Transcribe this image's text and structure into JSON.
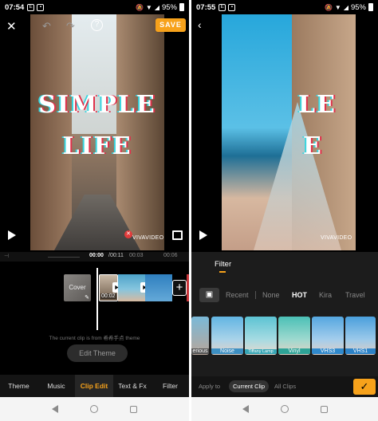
{
  "left": {
    "status": {
      "time": "07:54",
      "battery": "95%"
    },
    "top_bar": {
      "save_label": "SAVE"
    },
    "video": {
      "title_line1": "SIMPLE",
      "title_line2": "LIFE",
      "watermark": "VIVAVIDEO"
    },
    "timeline": {
      "current_time": "00:00",
      "total_time": "/00:11",
      "tick_1": "00:03",
      "tick_2": "00:06"
    },
    "clips": {
      "cover_label": "Cover",
      "clip_duration": "00:02",
      "hint": "The current clip is from 希希手点 theme",
      "edit_theme_label": "Edit Theme"
    },
    "tabs": [
      "Theme",
      "Music",
      "Clip Edit",
      "Text & Fx",
      "Filter"
    ],
    "active_tab": "Clip Edit"
  },
  "right": {
    "status": {
      "time": "07:55",
      "battery": "95%"
    },
    "video": {
      "title_fragment": "LE",
      "title_fragment_2": "E",
      "watermark": "VIVAVIDEO"
    },
    "filter": {
      "header": "Filter",
      "categories": [
        "Recent",
        "None",
        "HOT",
        "Kira",
        "Travel"
      ],
      "active_category": "HOT",
      "items": [
        "erious",
        "Noise",
        "Tiffany Lamp",
        "Vinyl",
        "VHS3",
        "VHS1"
      ],
      "apply_label": "Apply to",
      "current_clip_label": "Current Clip",
      "all_clips_label": "All Clips"
    }
  },
  "colors": {
    "accent": "#f7a21b",
    "active_tab": "#f7a21b"
  }
}
